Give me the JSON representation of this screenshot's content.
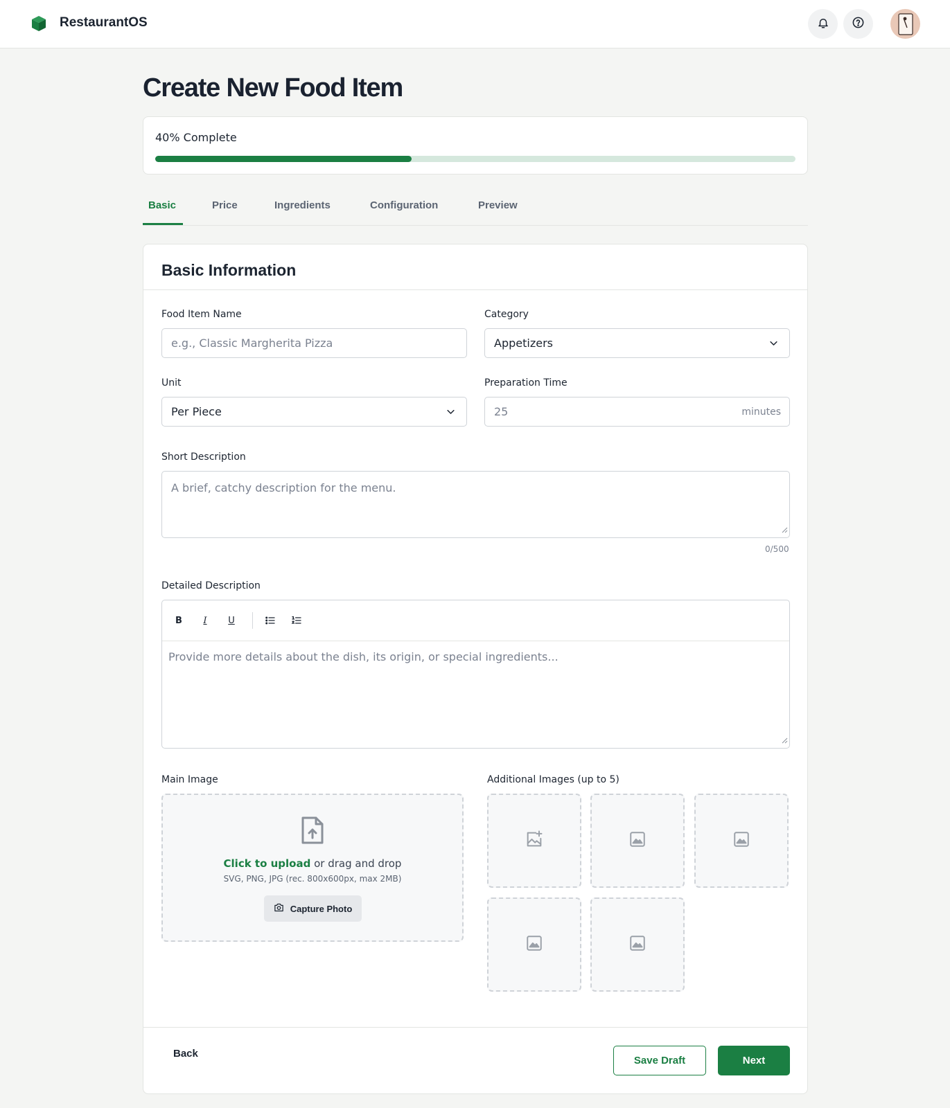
{
  "app": {
    "brand": "RestaurantOS"
  },
  "page": {
    "title": "Create New Food Item"
  },
  "progress": {
    "label": "40% Complete",
    "percent": 40
  },
  "tabs": [
    {
      "label": "Basic",
      "active": true
    },
    {
      "label": "Price",
      "active": false
    },
    {
      "label": "Ingredients",
      "active": false
    },
    {
      "label": "Configuration",
      "active": false
    },
    {
      "label": "Preview",
      "active": false
    }
  ],
  "form": {
    "section_title": "Basic Information",
    "name": {
      "label": "Food Item Name",
      "placeholder": "e.g., Classic Margherita Pizza"
    },
    "category": {
      "label": "Category",
      "value": "Appetizers"
    },
    "unit": {
      "label": "Unit",
      "value": "Per Piece"
    },
    "prep_time": {
      "label": "Preparation Time",
      "value": "25",
      "suffix": "minutes"
    },
    "short_desc": {
      "label": "Short Description",
      "placeholder": "A brief, catchy description for the menu.",
      "counter": "0/500"
    },
    "detailed_desc": {
      "label": "Detailed Description",
      "placeholder": "Provide more details about the dish, its origin, or special ingredients...",
      "toolbar": {
        "bold": "B",
        "italic": "I",
        "underline": "U"
      }
    },
    "main_image": {
      "label": "Main Image",
      "upload_link": "Click to upload",
      "upload_text": "or drag and drop",
      "hint": "SVG, PNG, JPG (rec. 800x600px, max 2MB)",
      "capture_label": "Capture Photo"
    },
    "additional_images": {
      "label": "Additional Images (up to 5)"
    }
  },
  "footer": {
    "back": "Back",
    "save_draft": "Save Draft",
    "next": "Next"
  },
  "colors": {
    "accent": "#1b7f43",
    "track": "#d5e8dd",
    "background": "#f4f5f3"
  }
}
